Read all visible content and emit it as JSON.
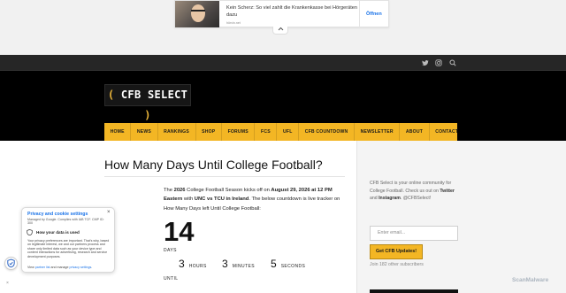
{
  "ad": {
    "text": "Kein Scherz: So viel zahlt die Krankenkasse bei Hörgeräten dazu",
    "source": "hörvin.net",
    "cta": "Öffnen",
    "collapse_icon": "chevron-up-icon"
  },
  "topbar": {
    "icons": [
      "twitter-icon",
      "instagram-icon",
      "search-icon"
    ]
  },
  "logo": {
    "open": "(",
    "text": "CFB SELECT",
    "close": ")"
  },
  "nav": {
    "items": [
      "HOME",
      "NEWS",
      "RANKINGS",
      "SHOP",
      "FORUMS",
      "FCS",
      "UFL",
      "CFB COUNTDOWN",
      "NEWSLETTER",
      "ABOUT",
      "CONTACT"
    ]
  },
  "page": {
    "title": "How Many Days Until College Football?",
    "intro": {
      "p1": "The ",
      "year": "2026",
      "p2": " College Football Season kicks off on ",
      "date": "August 29, 2026 at 12 PM Eastern",
      "p3": " with ",
      "game": "UNC vs TCU in Ireland",
      "p4": ". The below countdown is live tracker on How Many Days left Until College Football:"
    }
  },
  "countdown": {
    "days": "14",
    "days_label": "DAYS",
    "hours": "3",
    "hours_label": "HOURS",
    "minutes": "3",
    "minutes_label": "MINUTES",
    "seconds": "5",
    "seconds_label": "SECONDS",
    "until_label": "UNTIL"
  },
  "sidebar": {
    "text1": "CFB Select is your online community for College Football. Check us out on ",
    "twitter": "Twitter",
    "text2": " and ",
    "instagram": "Instagram",
    "text3": ". @CFBSelect!",
    "email_placeholder": "Enter email...",
    "button": "Get CFB Updates!",
    "subscribers": "Join 182 other subscribers"
  },
  "consent": {
    "title": "Privacy and cookie settings",
    "subtitle": "Managed by Google. Complies with IAB TCF. CMP ID: 300",
    "how_used": "How your data is used",
    "body": "Your privacy preferences are important. That's why, based on legitimate interest, we and our partners process and share only limited data such as your device type and content interactions for advertising, research and service development purposes.",
    "links_prefix": "View ",
    "partner_list": "partner list",
    "links_middle": " and manage ",
    "privacy_settings": "privacy settings",
    "links_suffix": ".",
    "close": "×"
  },
  "floating": {
    "shield_icon": "shield-icon",
    "close": "×"
  },
  "watermark": "ScanMalware",
  "colors": {
    "accent": "#f3b624",
    "header_bg": "#000000",
    "topbar_bg": "#262626",
    "link": "#1a73e8"
  }
}
